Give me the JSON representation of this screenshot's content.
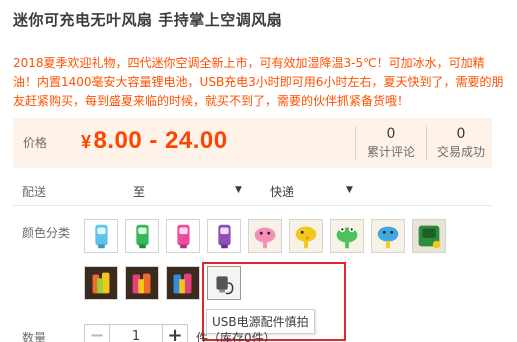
{
  "product": {
    "title": "迷你可充电无叶风扇 手持掌上空调风扇",
    "description": "2018夏季欢迎礼物，四代迷你空调全新上市，可有效加湿降温3-5℃！可加冰水，可加精油！内置1400毫安大容量锂电池，USB充电3小时即可用6小时左右，夏天快到了，需要的朋友赶紧购买，每到盛夏来临的时候，就买不到了，需要的伙伴抓紧备货哦！"
  },
  "price": {
    "label": "价格",
    "currency": "¥",
    "range": "8.00 - 24.00",
    "color": "#ff4400"
  },
  "stats": [
    {
      "num": "0",
      "label": "累计评论"
    },
    {
      "num": "0",
      "label": "交易成功"
    }
  ],
  "shipping": {
    "label": "配送",
    "to_label": "至",
    "dropdown_icon": "triangle-down-icon",
    "method": "快递"
  },
  "color": {
    "label": "颜色分类",
    "options": [
      {
        "name": "blue-fan",
        "color": "#5fc3e8"
      },
      {
        "name": "green-fan",
        "color": "#35b85a"
      },
      {
        "name": "pink-fan",
        "color": "#e94d9b"
      },
      {
        "name": "purple-fan",
        "color": "#8d4fb5"
      },
      {
        "name": "pink-pig-fan",
        "color": "#f58fb6"
      },
      {
        "name": "yellow-duck-fan",
        "color": "#f4c81b"
      },
      {
        "name": "green-frog-fan",
        "color": "#4ec25a"
      },
      {
        "name": "blue-dino-fan",
        "color": "#3ea7e4"
      },
      {
        "name": "green-cactus-fan",
        "color": "#2e8b3a"
      },
      {
        "name": "rainbow-fan-a",
        "color": "#f26a2e"
      },
      {
        "name": "rainbow-fan-b",
        "color": "#e83f7a"
      },
      {
        "name": "rainbow-fan-c",
        "color": "#2f8ee0"
      },
      {
        "name": "usb-power-cable",
        "color": "#555555"
      }
    ],
    "tooltip": "USB电源配件慎拍"
  },
  "quantity": {
    "label": "数量",
    "value": "1",
    "minus": "−",
    "plus": "+",
    "after_text": "件（库存0件）"
  }
}
